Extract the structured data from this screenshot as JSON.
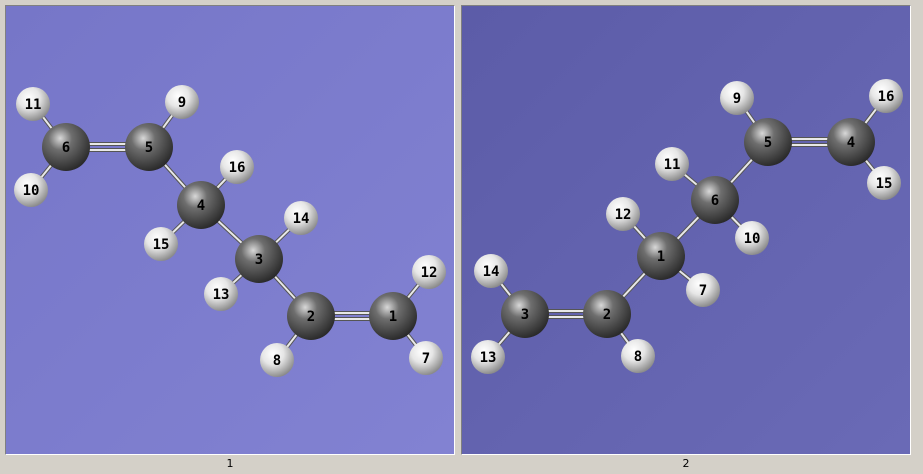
{
  "colors": {
    "panel_1_background": "#7a7acc",
    "panel_2_background": "#6262ae",
    "window_background": "#d4d0c8",
    "carbon": "#6e6e6e",
    "hydrogen": "#e6e6e6",
    "bond": "#e8e8e8"
  },
  "structures": [
    {
      "caption": "1",
      "atoms": [
        {
          "label": "1",
          "element": "C"
        },
        {
          "label": "2",
          "element": "C"
        },
        {
          "label": "3",
          "element": "C"
        },
        {
          "label": "4",
          "element": "C"
        },
        {
          "label": "5",
          "element": "C"
        },
        {
          "label": "6",
          "element": "C"
        },
        {
          "label": "7",
          "element": "H"
        },
        {
          "label": "8",
          "element": "H"
        },
        {
          "label": "9",
          "element": "H"
        },
        {
          "label": "10",
          "element": "H"
        },
        {
          "label": "11",
          "element": "H"
        },
        {
          "label": "12",
          "element": "H"
        },
        {
          "label": "13",
          "element": "H"
        },
        {
          "label": "14",
          "element": "H"
        },
        {
          "label": "15",
          "element": "H"
        },
        {
          "label": "16",
          "element": "H"
        }
      ],
      "bonds": [
        {
          "a": "1",
          "b": "2",
          "order": 2
        },
        {
          "a": "2",
          "b": "3",
          "order": 1
        },
        {
          "a": "3",
          "b": "4",
          "order": 1
        },
        {
          "a": "4",
          "b": "5",
          "order": 1
        },
        {
          "a": "5",
          "b": "6",
          "order": 2
        },
        {
          "a": "1",
          "b": "7",
          "order": 1
        },
        {
          "a": "1",
          "b": "12",
          "order": 1
        },
        {
          "a": "2",
          "b": "8",
          "order": 1
        },
        {
          "a": "3",
          "b": "13",
          "order": 1
        },
        {
          "a": "3",
          "b": "14",
          "order": 1
        },
        {
          "a": "4",
          "b": "15",
          "order": 1
        },
        {
          "a": "4",
          "b": "16",
          "order": 1
        },
        {
          "a": "5",
          "b": "9",
          "order": 1
        },
        {
          "a": "6",
          "b": "10",
          "order": 1
        },
        {
          "a": "6",
          "b": "11",
          "order": 1
        }
      ]
    },
    {
      "caption": "2",
      "atoms": [
        {
          "label": "1",
          "element": "C"
        },
        {
          "label": "2",
          "element": "C"
        },
        {
          "label": "3",
          "element": "C"
        },
        {
          "label": "4",
          "element": "C"
        },
        {
          "label": "5",
          "element": "C"
        },
        {
          "label": "6",
          "element": "C"
        },
        {
          "label": "7",
          "element": "H"
        },
        {
          "label": "8",
          "element": "H"
        },
        {
          "label": "9",
          "element": "H"
        },
        {
          "label": "10",
          "element": "H"
        },
        {
          "label": "11",
          "element": "H"
        },
        {
          "label": "12",
          "element": "H"
        },
        {
          "label": "13",
          "element": "H"
        },
        {
          "label": "14",
          "element": "H"
        },
        {
          "label": "15",
          "element": "H"
        },
        {
          "label": "16",
          "element": "H"
        }
      ],
      "bonds": [
        {
          "a": "3",
          "b": "2",
          "order": 2
        },
        {
          "a": "2",
          "b": "1",
          "order": 1
        },
        {
          "a": "1",
          "b": "6",
          "order": 1
        },
        {
          "a": "6",
          "b": "5",
          "order": 1
        },
        {
          "a": "5",
          "b": "4",
          "order": 2
        },
        {
          "a": "3",
          "b": "13",
          "order": 1
        },
        {
          "a": "3",
          "b": "14",
          "order": 1
        },
        {
          "a": "2",
          "b": "8",
          "order": 1
        },
        {
          "a": "1",
          "b": "7",
          "order": 1
        },
        {
          "a": "1",
          "b": "12",
          "order": 1
        },
        {
          "a": "6",
          "b": "10",
          "order": 1
        },
        {
          "a": "6",
          "b": "11",
          "order": 1
        },
        {
          "a": "5",
          "b": "9",
          "order": 1
        },
        {
          "a": "4",
          "b": "15",
          "order": 1
        },
        {
          "a": "4",
          "b": "16",
          "order": 1
        }
      ]
    }
  ]
}
